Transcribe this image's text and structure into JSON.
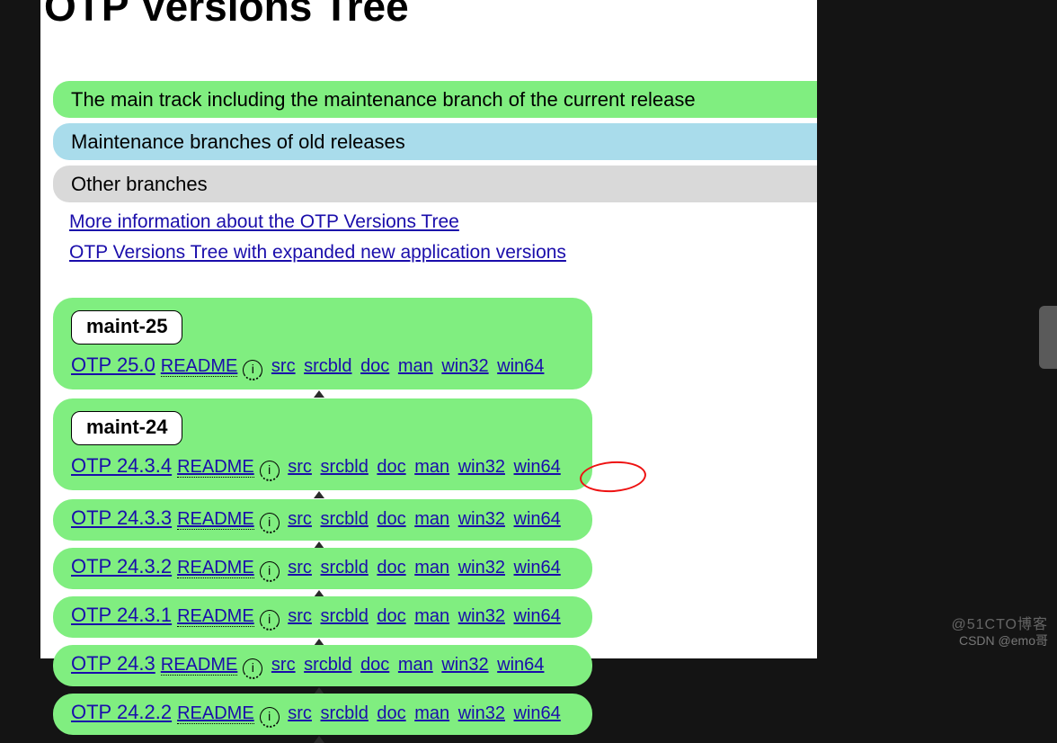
{
  "title": "OTP Versions Tree",
  "legend": {
    "main": "The main track including the maintenance branch of the current release",
    "maint": "Maintenance branches of old releases",
    "other": "Other branches"
  },
  "links": {
    "more": "More information about the OTP Versions Tree",
    "expanded": "OTP Versions Tree with expanded new application versions"
  },
  "labels": {
    "readme": "README",
    "info_glyph": "i",
    "downloads": [
      "src",
      "srcbld",
      "doc",
      "man",
      "win32",
      "win64"
    ]
  },
  "branches": [
    {
      "name": "maint-25",
      "versions": [
        {
          "label": "OTP 25.0"
        }
      ]
    },
    {
      "name": "maint-24",
      "versions": [
        {
          "label": "OTP 24.3.4",
          "circled_win64": true
        },
        {
          "label": "OTP 24.3.3"
        },
        {
          "label": "OTP 24.3.2"
        },
        {
          "label": "OTP 24.3.1"
        },
        {
          "label": "OTP 24.3"
        },
        {
          "label": "OTP 24.2.2"
        }
      ]
    }
  ],
  "watermarks": {
    "a": "@51CTO博客",
    "b": "CSDN @emo哥"
  }
}
